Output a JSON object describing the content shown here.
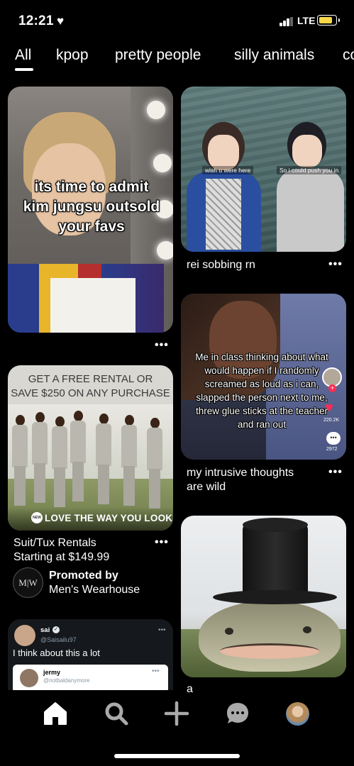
{
  "status_bar": {
    "time": "12:21",
    "network": "LTE"
  },
  "tabs": [
    {
      "label": "All",
      "active": true
    },
    {
      "label": "kpop"
    },
    {
      "label": "pretty people"
    },
    {
      "label": "silly animals"
    },
    {
      "label": "co"
    }
  ],
  "pins": {
    "kpop": {
      "overlay_text": "its time to admit kim jungsu outsold your favs"
    },
    "anime": {
      "caption": "rei sobbing rn",
      "subtitle_left": "wish u were here",
      "subtitle_right": "So i could push you in"
    },
    "ad": {
      "headline_line1": "GET A FREE RENTAL OR",
      "headline_line2": "SAVE $250 ON ANY PURCHASE",
      "banner": "LOVE THE WAY YOU LOOK",
      "logo_mark": "NEW",
      "title_line1": "Suit/Tux Rentals",
      "title_line2": "Starting at $149.99",
      "promoted_by": "Promoted by",
      "advertiser": "Men's Wearhouse",
      "advertiser_logo": "M|W"
    },
    "classroom": {
      "overlay_text": "Me in class thinking about what would happen if I randomly screamed as loud as i can, slapped the person next to me, threw glue sticks at the teacher and ran out",
      "likes": "220.2K",
      "comments": "2972",
      "caption_line1": "my intrusive thoughts",
      "caption_line2": "are wild"
    },
    "tweet": {
      "name": "sai",
      "handle": "@Saisailu97",
      "text": "I think about this a lot",
      "quoted_name": "jermy",
      "quoted_handle": "@notbaldanymore"
    },
    "catfish": {
      "caption": "a"
    }
  },
  "more_label": "•••",
  "colors": {
    "background": "#000000",
    "battery": "#f7d94a",
    "tiktok_red": "#fe2c55"
  },
  "bottom_nav": [
    "home-icon",
    "search-icon",
    "plus-icon",
    "chat-icon",
    "profile-avatar"
  ]
}
